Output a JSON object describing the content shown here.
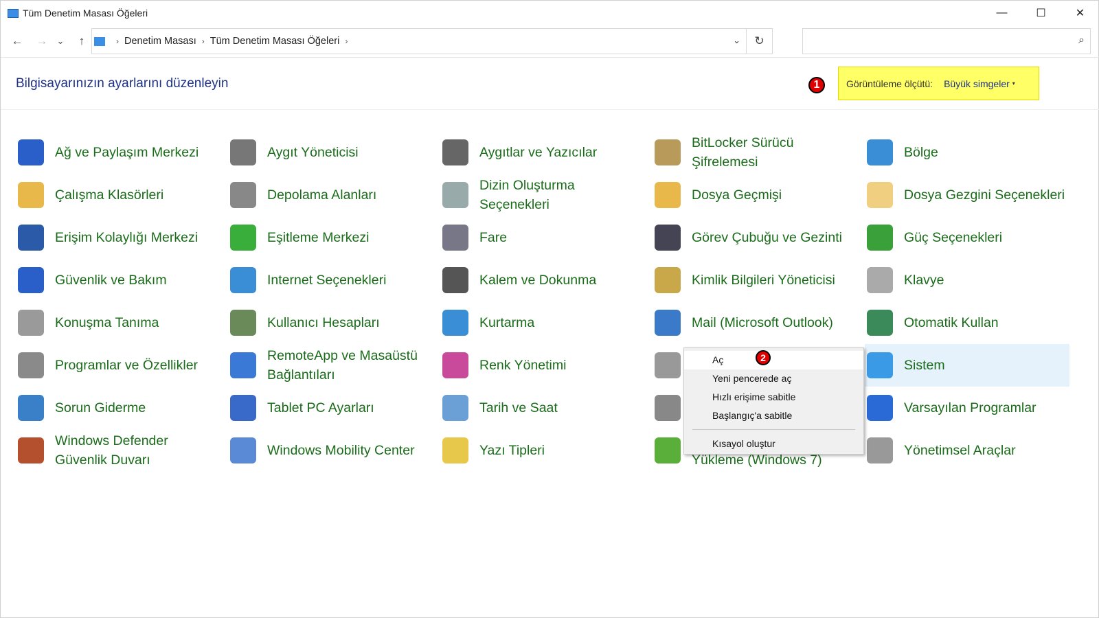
{
  "window": {
    "title": "Tüm Denetim Masası Öğeleri",
    "minimize": "—",
    "maximize": "☐",
    "close": "✕"
  },
  "nav": {
    "back": "←",
    "forward": "→",
    "recent": "⌄",
    "up": "↑",
    "breadcrumb": [
      "Denetim Masası",
      "Tüm Denetim Masası Öğeleri"
    ],
    "sep": "›",
    "dropdown": "⌄",
    "refresh": "↻",
    "search_placeholder": "",
    "search_icon": "⌕"
  },
  "heading": "Bilgisayarınızın ayarlarını düzenleyin",
  "view": {
    "label": "Görüntüleme ölçütü:",
    "value": "Büyük simgeler",
    "caret": "▾"
  },
  "badges": [
    "1",
    "2"
  ],
  "columns": [
    [
      {
        "label": "Ağ ve Paylaşım Merkezi",
        "color": "#2a5fc9"
      },
      {
        "label": "Çalışma Klasörleri",
        "color": "#e8b84a"
      },
      {
        "label": "Erişim Kolaylığı Merkezi",
        "color": "#2a5aa8"
      },
      {
        "label": "Güvenlik ve Bakım",
        "color": "#2a5fc9"
      },
      {
        "label": "Konuşma Tanıma",
        "color": "#9a9a9a"
      },
      {
        "label": "Programlar ve Özellikler",
        "color": "#8a8a8a"
      },
      {
        "label": "Sorun Giderme",
        "color": "#3a80c9"
      },
      {
        "label": "Windows Defender Güvenlik Duvarı",
        "color": "#b5502e"
      }
    ],
    [
      {
        "label": "Aygıt Yöneticisi",
        "color": "#777"
      },
      {
        "label": "Depolama Alanları",
        "color": "#888"
      },
      {
        "label": "Eşitleme Merkezi",
        "color": "#3aae3a"
      },
      {
        "label": "Internet Seçenekleri",
        "color": "#3a8ed6"
      },
      {
        "label": "Kullanıcı Hesapları",
        "color": "#6a8a5a"
      },
      {
        "label": "RemoteApp ve Masaüstü Bağlantıları",
        "color": "#3a7ad6"
      },
      {
        "label": "Tablet PC Ayarları",
        "color": "#3a6ac9"
      },
      {
        "label": "Windows Mobility Center",
        "color": "#5a8ad6"
      }
    ],
    [
      {
        "label": "Aygıtlar ve Yazıcılar",
        "color": "#666"
      },
      {
        "label": "Dizin Oluşturma Seçenekleri",
        "color": "#9aa"
      },
      {
        "label": "Fare",
        "color": "#778"
      },
      {
        "label": "Kalem ve Dokunma",
        "color": "#555"
      },
      {
        "label": "Kurtarma",
        "color": "#3a8ed6"
      },
      {
        "label": "Renk Yönetimi",
        "color": "#c94a9a"
      },
      {
        "label": "Tarih ve Saat",
        "color": "#6aa0d6"
      },
      {
        "label": "Yazı Tipleri",
        "color": "#e8c84a"
      }
    ],
    [
      {
        "label": "BitLocker Sürücü Şifrelemesi",
        "color": "#b89a5a"
      },
      {
        "label": "Dosya Geçmişi",
        "color": "#e8b84a"
      },
      {
        "label": "Görev Çubuğu ve Gezinti",
        "color": "#445"
      },
      {
        "label": "Kimlik Bilgileri Yöneticisi",
        "color": "#c9a84a"
      },
      {
        "label": "Mail (Microsoft Outlook)",
        "color": "#3a7ac9"
      },
      {
        "label": "",
        "color": "#999"
      },
      {
        "label": "",
        "color": "#888"
      },
      {
        "label": "Yükleme (Windows 7)",
        "color": "#5aae3a"
      }
    ],
    [
      {
        "label": "Bölge",
        "color": "#3a8ed6"
      },
      {
        "label": "Dosya Gezgini Seçenekleri",
        "color": "#f0d080"
      },
      {
        "label": "Güç Seçenekleri",
        "color": "#3aa03a"
      },
      {
        "label": "Klavye",
        "color": "#aaa"
      },
      {
        "label": "Otomatik Kullan",
        "color": "#3a8a5a"
      },
      {
        "label": "Sistem",
        "color": "#3a9ae6"
      },
      {
        "label": "Varsayılan Programlar",
        "color": "#2a6ad6"
      },
      {
        "label": "Yönetimsel Araçlar",
        "color": "#999"
      }
    ]
  ],
  "context_menu": {
    "items": [
      "Aç",
      "Yeni pencerede aç",
      "Hızlı erişime sabitle",
      "Başlangıç'a sabitle",
      "Kısayol oluştur"
    ]
  }
}
